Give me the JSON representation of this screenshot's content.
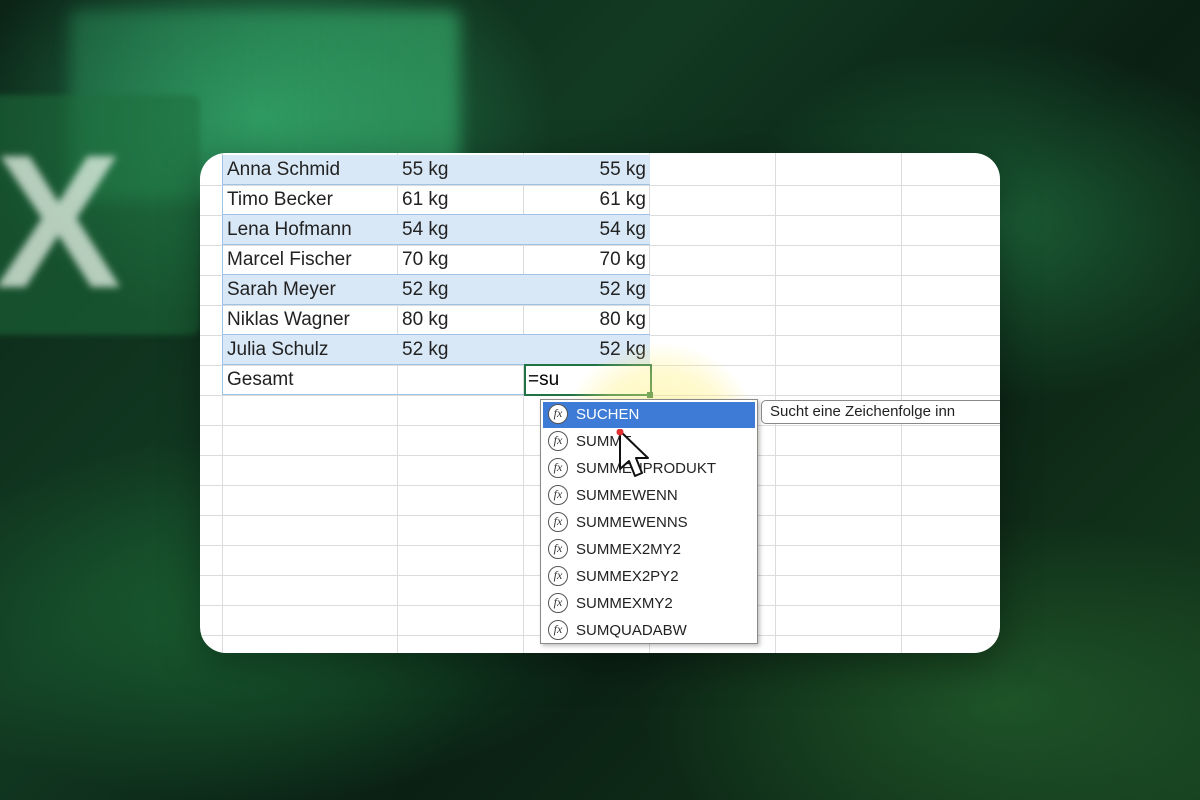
{
  "sheet": {
    "rows": [
      {
        "name": "Anna Schmid",
        "weight": "55 kg",
        "value": "55 kg"
      },
      {
        "name": "Timo Becker",
        "weight": "61 kg",
        "value": "61 kg"
      },
      {
        "name": "Lena Hofmann",
        "weight": "54 kg",
        "value": "54 kg"
      },
      {
        "name": "Marcel Fischer",
        "weight": "70 kg",
        "value": "70 kg"
      },
      {
        "name": "Sarah Meyer",
        "weight": "52 kg",
        "value": "52 kg"
      },
      {
        "name": "Niklas Wagner",
        "weight": "80 kg",
        "value": "80 kg"
      },
      {
        "name": "Julia Schulz",
        "weight": "52 kg",
        "value": "52 kg"
      }
    ],
    "total_label": "Gesamt",
    "formula_input": "=su"
  },
  "autocomplete": {
    "items": [
      "SUCHEN",
      "SUMME",
      "SUMMENPRODUKT",
      "SUMMEWENN",
      "SUMMEWENNS",
      "SUMMEX2MY2",
      "SUMMEX2PY2",
      "SUMMEXMY2",
      "SUMQUADABW"
    ],
    "selected_index": 0,
    "icon_glyph": "fx",
    "tooltip": "Sucht eine Zeichenfolge inn"
  },
  "colors": {
    "table_band": "#d9e8f6",
    "selection": "#3d7bd6",
    "cell_border": "#217346"
  },
  "icons": {
    "background_logo": "excel-logo",
    "pointer": "mouse-cursor"
  },
  "background_logo_letter": "X"
}
